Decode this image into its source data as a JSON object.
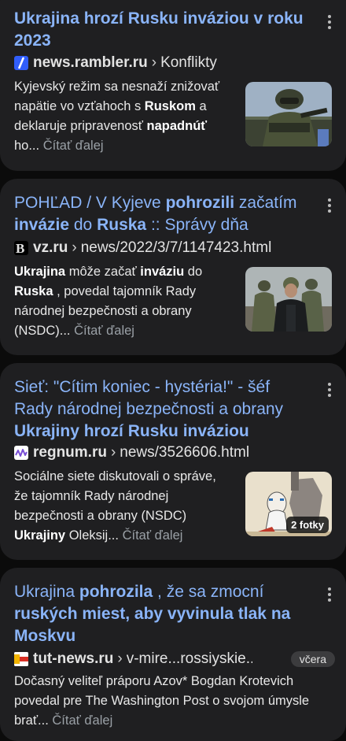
{
  "cards": [
    {
      "title_parts": [
        {
          "t": "Ukrajina hrozí Rusku inváziou v roku 2023",
          "b": true
        }
      ],
      "site": "news.rambler.ru",
      "path": "Konflikty",
      "snippet_parts": [
        {
          "t": "Kyjevský režim sa nesnaží znižovať napätie vo vzťahoch s ",
          "b": false
        },
        {
          "t": "Ruskom",
          "b": true
        },
        {
          "t": " a deklaruje pripravenosť ",
          "b": false
        },
        {
          "t": "napadnúť",
          "b": true
        },
        {
          "t": " ho... ",
          "b": false
        }
      ],
      "read_more": "Čítať ďalej",
      "favicon_icon": "rambler-slash-icon",
      "favicon_color": "#315efb"
    },
    {
      "title_parts": [
        {
          "t": "POHĽAD / V Kyjeve ",
          "b": false
        },
        {
          "t": "pohrozili",
          "b": true
        },
        {
          "t": " začatím ",
          "b": false
        },
        {
          "t": "invázie",
          "b": true
        },
        {
          "t": " do ",
          "b": false
        },
        {
          "t": "Ruska",
          "b": true
        },
        {
          "t": " :: Správy dňa",
          "b": false
        }
      ],
      "site": "vz.ru",
      "path": "news/2022/3/7/1147423.html",
      "snippet_parts": [
        {
          "t": "Ukrajina",
          "b": true
        },
        {
          "t": " môže začať ",
          "b": false
        },
        {
          "t": "inváziu",
          "b": true
        },
        {
          "t": " do ",
          "b": false
        },
        {
          "t": "Ruska",
          "b": true
        },
        {
          "t": " , povedal tajomník Rady národnej bezpečnosti a obrany (NSDC)... ",
          "b": false
        }
      ],
      "read_more": "Čítať ďalej",
      "favicon_icon": "vz-letter-b-icon",
      "favicon_color": "#000000"
    },
    {
      "title_parts": [
        {
          "t": "Sieť: \"Cítim koniec - hystéria!\" - šéf Rady národnej bezpečnosti a obrany ",
          "b": false
        },
        {
          "t": "Ukrajiny hrozí Rusku inváziou",
          "b": true
        }
      ],
      "site": "regnum.ru",
      "path": "news/3526606.html",
      "snippet_parts": [
        {
          "t": "Sociálne siete diskutovali o správe, že tajomník Rady národnej bezpečnosti a obrany (NSDC) ",
          "b": false
        },
        {
          "t": "Ukrajiny",
          "b": true
        },
        {
          "t": " Oleksij... ",
          "b": false
        }
      ],
      "read_more": "Čítať ďalej",
      "badge": "2 fotky",
      "favicon_icon": "regnum-wave-icon",
      "favicon_color": "#7a4fd6"
    },
    {
      "title_parts": [
        {
          "t": "Ukrajina",
          "b": false
        },
        {
          "t": " pohrozila",
          "b": true
        },
        {
          "t": " , že sa zmocní ",
          "b": false
        },
        {
          "t": "ruských miest, aby vyvinula tlak na Moskvu",
          "b": true
        }
      ],
      "site": "tut-news.ru",
      "path": "v-mire...rossiyskie...",
      "chip": "včera",
      "snippet_parts": [
        {
          "t": "Dočasný veliteľ práporu Azov* Bogdan Krotevich povedal pre The Washington Post o svojom úmysle brať... ",
          "b": false
        }
      ],
      "read_more": "Čítať ďalej",
      "favicon_icon": "tut-news-flag-icon",
      "favicon_color": "#d93025"
    }
  ],
  "separator": "›"
}
